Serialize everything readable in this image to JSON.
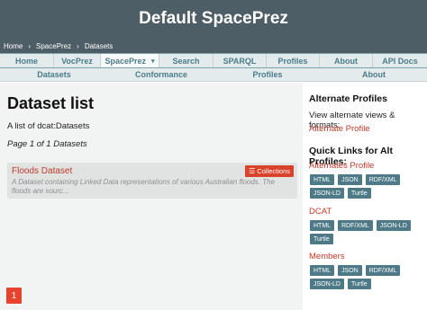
{
  "header": {
    "title": "Default SpacePrez",
    "breadcrumb": [
      "Home",
      "SpacePrez",
      "Datasets"
    ]
  },
  "nav": {
    "items": [
      {
        "label": "Home"
      },
      {
        "label": "VocPrez"
      },
      {
        "label": "SpacePrez",
        "active": true
      },
      {
        "label": "Search"
      },
      {
        "label": "SPARQL"
      },
      {
        "label": "Profiles"
      },
      {
        "label": "About"
      },
      {
        "label": "API Docs"
      }
    ],
    "sub_items": [
      "Datasets",
      "Conformance",
      "Profiles",
      "About"
    ]
  },
  "main": {
    "title": "Dataset list",
    "description": "A list of dcat:Datasets",
    "pagination_text": "Page 1 of 1 Datasets",
    "items": [
      {
        "title": "Floods Dataset",
        "description": "A Dataset containing Linked Data representations of various Australian floods. The floods are sourc...",
        "button_label": "Collections",
        "button_icon": "list-icon"
      }
    ],
    "current_page": "1"
  },
  "sidebar": {
    "alt_title": "Alternate Profiles",
    "alt_text": "View alternate views & formats:",
    "alt_link": "Alternate Profile",
    "quick_title": "Quick Links for Alt Profiles:",
    "groups": [
      {
        "title": "Alternates Profile",
        "formats": [
          "HTML",
          "JSON",
          "RDF/XML",
          "JSON-LD",
          "Turtle"
        ]
      },
      {
        "title": "DCAT",
        "formats": [
          "HTML",
          "RDF/XML",
          "JSON-LD",
          "Turtle"
        ]
      },
      {
        "title": "Members",
        "formats": [
          "HTML",
          "JSON",
          "RDF/XML",
          "JSON-LD",
          "Turtle"
        ]
      }
    ]
  },
  "colors": {
    "header_bg": "#4d5e66",
    "link": "#c0392b",
    "accent_button": "#d9432b",
    "format_button": "#4d7a86",
    "nav_text": "#4a7c8a"
  }
}
